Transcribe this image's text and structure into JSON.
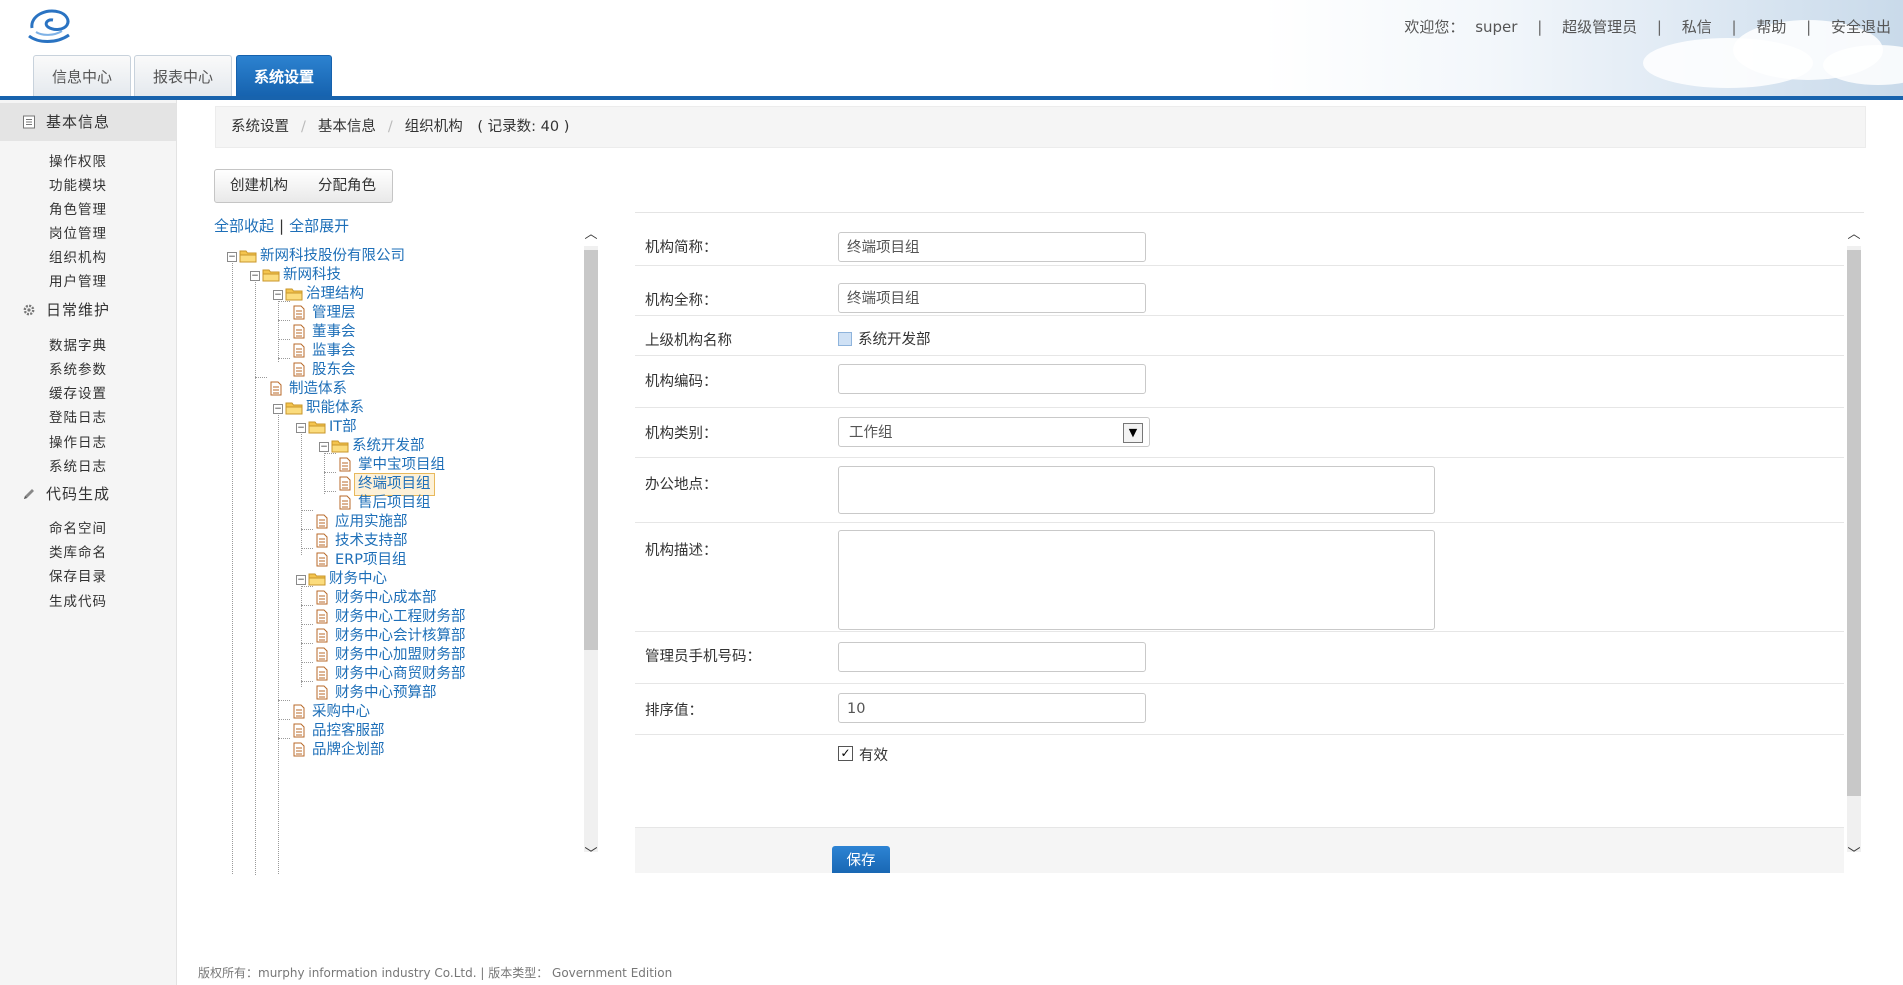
{
  "header": {
    "welcome": "欢迎您：",
    "user": "super",
    "role": "超级管理员",
    "links": [
      "私信",
      "帮助",
      "安全退出"
    ],
    "separator": "|",
    "tabs": [
      {
        "label": "信息中心",
        "active": false
      },
      {
        "label": "报表中心",
        "active": false
      },
      {
        "label": "系统设置",
        "active": true
      }
    ]
  },
  "sidebar": {
    "groups": [
      {
        "label": "基本信息",
        "icon": "document-icon",
        "items": [
          "操作权限",
          "功能模块",
          "角色管理",
          "岗位管理",
          "组织机构",
          "用户管理"
        ]
      },
      {
        "label": "日常维护",
        "icon": "gear-icon",
        "items": [
          "数据字典",
          "系统参数",
          "缓存设置",
          "登陆日志",
          "操作日志",
          "系统日志"
        ]
      },
      {
        "label": "代码生成",
        "icon": "pencil-icon",
        "items": [
          "命名空间",
          "类库命名",
          "保存目录",
          "生成代码"
        ]
      }
    ]
  },
  "breadcrumb": {
    "items": [
      "系统设置",
      "基本信息",
      "组织机构"
    ],
    "separator": "/",
    "record_count": "( 记录数: 40 )"
  },
  "toolbar": {
    "create_label": "创建机构",
    "assign_label": "分配角色"
  },
  "tree_controls": {
    "collapse_all": "全部收起",
    "expand_all": "全部展开",
    "bar": "|"
  },
  "tree": [
    "新网科技股份有限公司",
    "新网科技",
    "治理结构",
    "管理层",
    "董事会",
    "监事会",
    "股东会",
    "制造体系",
    "职能体系",
    "IT部",
    "系统开发部",
    "掌中宝项目组",
    "终端项目组",
    "售后项目组",
    "应用实施部",
    "技术支持部",
    "ERP项目组",
    "财务中心",
    "财务中心成本部",
    "财务中心工程财务部",
    "财务中心会计核算部",
    "财务中心加盟财务部",
    "财务中心商贸财务部",
    "财务中心预算部",
    "采购中心",
    "品控客服部",
    "品牌企划部"
  ],
  "form": {
    "short_name_label": "机构简称：",
    "short_name_value": "终端项目组",
    "full_name_label": "机构全称：",
    "full_name_value": "终端项目组",
    "parent_label": "上级机构名称",
    "parent_value": "系统开发部",
    "code_label": "机构编码：",
    "code_value": "",
    "type_label": "机构类别：",
    "type_value": "工作组",
    "location_label": "办公地点：",
    "location_value": "",
    "description_label": "机构描述：",
    "description_value": "",
    "phone_label": "管理员手机号码：",
    "phone_value": "",
    "sort_label": "排序值：",
    "sort_value": "10",
    "valid_label": "有效",
    "valid_checked": true,
    "save_label": "保存"
  },
  "footer": {
    "text": "版权所有：murphy information industry Co.Ltd. | 版本类型： Government Edition"
  },
  "colors": {
    "primary": "#1863ad",
    "link": "#1e6fb8",
    "sidebar_bg": "#f5f5f5"
  }
}
